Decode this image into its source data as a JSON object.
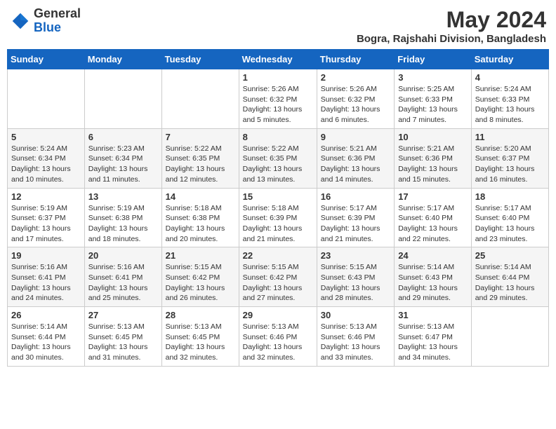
{
  "header": {
    "logo_general": "General",
    "logo_blue": "Blue",
    "month_year": "May 2024",
    "location": "Bogra, Rajshahi Division, Bangladesh"
  },
  "days_of_week": [
    "Sunday",
    "Monday",
    "Tuesday",
    "Wednesday",
    "Thursday",
    "Friday",
    "Saturday"
  ],
  "weeks": [
    [
      {
        "day": "",
        "info": ""
      },
      {
        "day": "",
        "info": ""
      },
      {
        "day": "",
        "info": ""
      },
      {
        "day": "1",
        "info": "Sunrise: 5:26 AM\nSunset: 6:32 PM\nDaylight: 13 hours\nand 5 minutes."
      },
      {
        "day": "2",
        "info": "Sunrise: 5:26 AM\nSunset: 6:32 PM\nDaylight: 13 hours\nand 6 minutes."
      },
      {
        "day": "3",
        "info": "Sunrise: 5:25 AM\nSunset: 6:33 PM\nDaylight: 13 hours\nand 7 minutes."
      },
      {
        "day": "4",
        "info": "Sunrise: 5:24 AM\nSunset: 6:33 PM\nDaylight: 13 hours\nand 8 minutes."
      }
    ],
    [
      {
        "day": "5",
        "info": "Sunrise: 5:24 AM\nSunset: 6:34 PM\nDaylight: 13 hours\nand 10 minutes."
      },
      {
        "day": "6",
        "info": "Sunrise: 5:23 AM\nSunset: 6:34 PM\nDaylight: 13 hours\nand 11 minutes."
      },
      {
        "day": "7",
        "info": "Sunrise: 5:22 AM\nSunset: 6:35 PM\nDaylight: 13 hours\nand 12 minutes."
      },
      {
        "day": "8",
        "info": "Sunrise: 5:22 AM\nSunset: 6:35 PM\nDaylight: 13 hours\nand 13 minutes."
      },
      {
        "day": "9",
        "info": "Sunrise: 5:21 AM\nSunset: 6:36 PM\nDaylight: 13 hours\nand 14 minutes."
      },
      {
        "day": "10",
        "info": "Sunrise: 5:21 AM\nSunset: 6:36 PM\nDaylight: 13 hours\nand 15 minutes."
      },
      {
        "day": "11",
        "info": "Sunrise: 5:20 AM\nSunset: 6:37 PM\nDaylight: 13 hours\nand 16 minutes."
      }
    ],
    [
      {
        "day": "12",
        "info": "Sunrise: 5:19 AM\nSunset: 6:37 PM\nDaylight: 13 hours\nand 17 minutes."
      },
      {
        "day": "13",
        "info": "Sunrise: 5:19 AM\nSunset: 6:38 PM\nDaylight: 13 hours\nand 18 minutes."
      },
      {
        "day": "14",
        "info": "Sunrise: 5:18 AM\nSunset: 6:38 PM\nDaylight: 13 hours\nand 20 minutes."
      },
      {
        "day": "15",
        "info": "Sunrise: 5:18 AM\nSunset: 6:39 PM\nDaylight: 13 hours\nand 21 minutes."
      },
      {
        "day": "16",
        "info": "Sunrise: 5:17 AM\nSunset: 6:39 PM\nDaylight: 13 hours\nand 21 minutes."
      },
      {
        "day": "17",
        "info": "Sunrise: 5:17 AM\nSunset: 6:40 PM\nDaylight: 13 hours\nand 22 minutes."
      },
      {
        "day": "18",
        "info": "Sunrise: 5:17 AM\nSunset: 6:40 PM\nDaylight: 13 hours\nand 23 minutes."
      }
    ],
    [
      {
        "day": "19",
        "info": "Sunrise: 5:16 AM\nSunset: 6:41 PM\nDaylight: 13 hours\nand 24 minutes."
      },
      {
        "day": "20",
        "info": "Sunrise: 5:16 AM\nSunset: 6:41 PM\nDaylight: 13 hours\nand 25 minutes."
      },
      {
        "day": "21",
        "info": "Sunrise: 5:15 AM\nSunset: 6:42 PM\nDaylight: 13 hours\nand 26 minutes."
      },
      {
        "day": "22",
        "info": "Sunrise: 5:15 AM\nSunset: 6:42 PM\nDaylight: 13 hours\nand 27 minutes."
      },
      {
        "day": "23",
        "info": "Sunrise: 5:15 AM\nSunset: 6:43 PM\nDaylight: 13 hours\nand 28 minutes."
      },
      {
        "day": "24",
        "info": "Sunrise: 5:14 AM\nSunset: 6:43 PM\nDaylight: 13 hours\nand 29 minutes."
      },
      {
        "day": "25",
        "info": "Sunrise: 5:14 AM\nSunset: 6:44 PM\nDaylight: 13 hours\nand 29 minutes."
      }
    ],
    [
      {
        "day": "26",
        "info": "Sunrise: 5:14 AM\nSunset: 6:44 PM\nDaylight: 13 hours\nand 30 minutes."
      },
      {
        "day": "27",
        "info": "Sunrise: 5:13 AM\nSunset: 6:45 PM\nDaylight: 13 hours\nand 31 minutes."
      },
      {
        "day": "28",
        "info": "Sunrise: 5:13 AM\nSunset: 6:45 PM\nDaylight: 13 hours\nand 32 minutes."
      },
      {
        "day": "29",
        "info": "Sunrise: 5:13 AM\nSunset: 6:46 PM\nDaylight: 13 hours\nand 32 minutes."
      },
      {
        "day": "30",
        "info": "Sunrise: 5:13 AM\nSunset: 6:46 PM\nDaylight: 13 hours\nand 33 minutes."
      },
      {
        "day": "31",
        "info": "Sunrise: 5:13 AM\nSunset: 6:47 PM\nDaylight: 13 hours\nand 34 minutes."
      },
      {
        "day": "",
        "info": ""
      }
    ]
  ]
}
